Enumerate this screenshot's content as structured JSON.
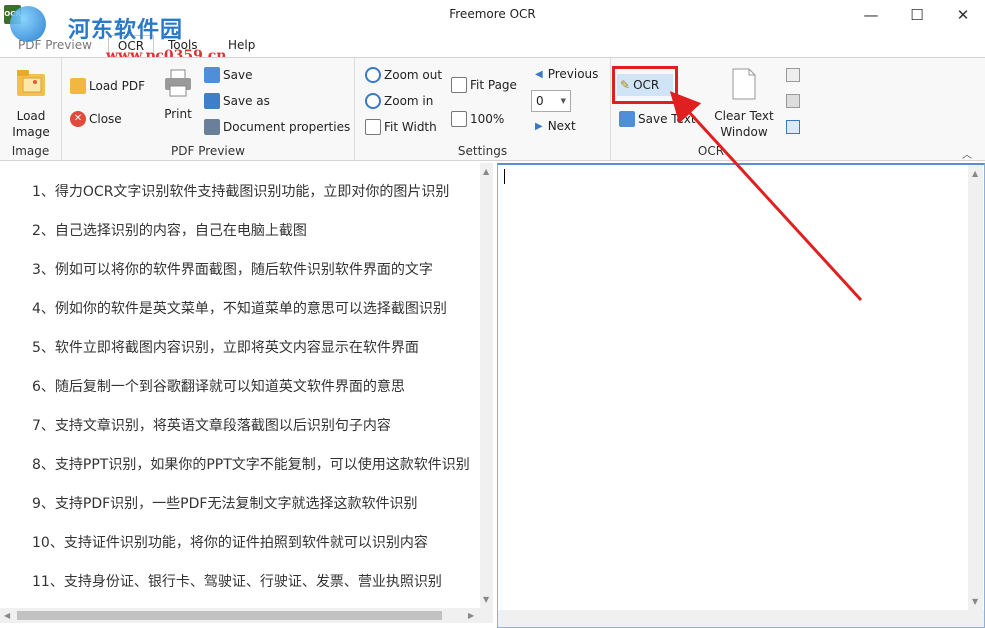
{
  "window": {
    "title": "Freemore OCR",
    "app_icon_text": "OCR",
    "minimize_glyph": "—",
    "maximize_glyph": "☐",
    "close_glyph": "✕"
  },
  "watermark": {
    "site_name": "河东软件园",
    "url": "www.pc0359.cn"
  },
  "menu_tabs": [
    "PDF Preview",
    "OCR",
    "Tools",
    "Help"
  ],
  "active_tab": "OCR",
  "ribbon": {
    "image_group": {
      "label": "Image",
      "load_image": "Load Image"
    },
    "pdf_group": {
      "label": "PDF Preview",
      "load_pdf": "Load PDF",
      "close": "Close",
      "print": "Print",
      "save": "Save",
      "save_as": "Save as",
      "document_properties": "Document properties"
    },
    "settings_group": {
      "label": "Settings",
      "zoom_out": "Zoom out",
      "zoom_in": "Zoom in",
      "fit_width": "Fit Width",
      "fit_page": "Fit Page",
      "zoom_100": "100%",
      "previous": "Previous",
      "page_value": "0",
      "next": "Next"
    },
    "ocr_group": {
      "label": "OCR",
      "ocr": "OCR",
      "save_text": "Save Text",
      "clear_text_window": "Clear Text Window"
    }
  },
  "left_text_lines": [
    "1、得力OCR文字识别软件支持截图识别功能，立即对你的图片识别",
    "2、自己选择识别的内容，自己在电脑上截图",
    "3、例如可以将你的软件界面截图，随后软件识别软件界面的文字",
    "4、例如你的软件是英文菜单，不知道菜单的意思可以选择截图识别",
    "5、软件立即将截图内容识别，立即将英文内容显示在软件界面",
    "6、随后复制一个到谷歌翻译就可以知道英文软件界面的意思",
    "7、支持文章识别，将英语文章段落截图以后识别句子内容",
    "8、支持PPT识别，如果你的PPT文字不能复制，可以使用这款软件识别",
    "9、支持PDF识别，一些PDF无法复制文字就选择这款软件识别",
    "10、支持证件识别功能，将你的证件拍照到软件就可以识别内容",
    "11、支持身份证、银行卡、驾驶证、行驶证、发票、营业执照识别"
  ],
  "colors": {
    "highlight": "#e02020",
    "accent": "#5b8fd0"
  }
}
